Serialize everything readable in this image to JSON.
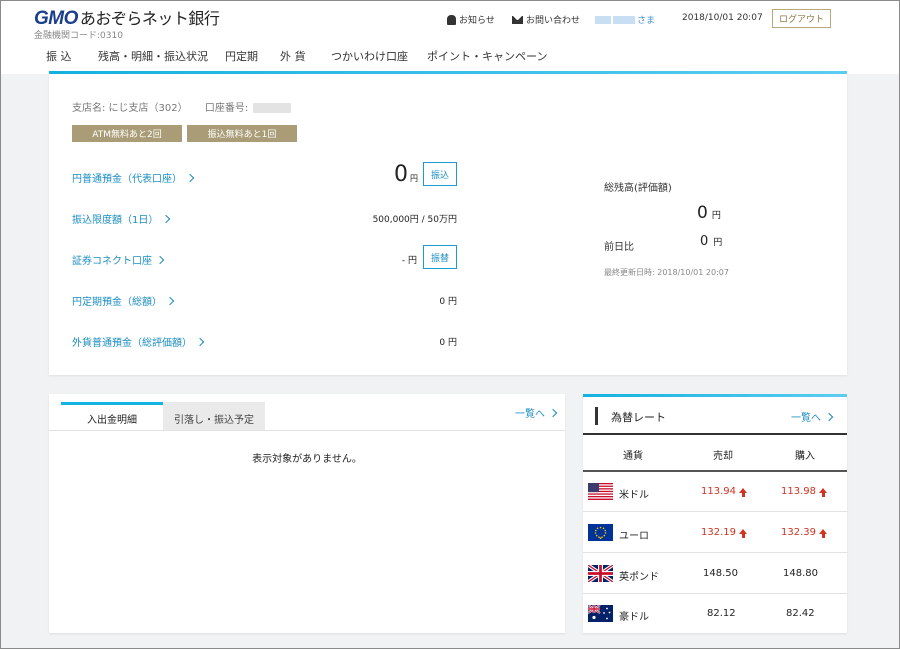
{
  "header": {
    "brand_gmo": "GMO",
    "brand_bank": "あおぞらネット銀行",
    "institution_code": "金融機関コード:0310",
    "notice": "お知らせ",
    "contact": "お問い合わせ",
    "user_suffix": "さま",
    "datetime": "2018/10/01 20:07",
    "logout": "ログアウト"
  },
  "nav": [
    {
      "label": "振 込"
    },
    {
      "label": "残高・明細・振込状況"
    },
    {
      "label": "円定期"
    },
    {
      "label": "外 貨"
    },
    {
      "label": "つかいわけ口座"
    },
    {
      "label": "ポイント・キャンペーン"
    }
  ],
  "account": {
    "branch": "支店名: にじ支店（302）",
    "account_label": "口座番号:",
    "badges": [
      "ATM無料あと2回",
      "振込無料あと1回"
    ],
    "rows": [
      {
        "label": "円普通預金（代表口座）",
        "amount": "0",
        "unit": "円",
        "button": "振込"
      },
      {
        "label": "振込限度額（1日）",
        "amount": "500,000円 / 50万円"
      },
      {
        "label": "証券コネクト口座",
        "amount": "- 円",
        "button": "振替"
      },
      {
        "label": "円定期預金（総額）",
        "amount": "0 円"
      },
      {
        "label": "外貨普通預金（総評価額）",
        "amount": "0 円"
      }
    ]
  },
  "summary": {
    "total_label": "総残高(評価額)",
    "total_amount": "0",
    "total_unit": "円",
    "prev_label": "前日比",
    "prev_amount": "0",
    "prev_unit": "円",
    "updated": "最終更新日時: 2018/10/01 20:07"
  },
  "transactions": {
    "tabs": [
      "入出金明細",
      "引落し・振込予定"
    ],
    "list_link": "一覧へ",
    "empty_message": "表示対象がありません。"
  },
  "fx": {
    "title": "為替レート",
    "list_link": "一覧へ",
    "headers": [
      "通貨",
      "売却",
      "購入"
    ],
    "rows": [
      {
        "name": "米ドル",
        "sell": "113.94",
        "buy": "113.98",
        "sell_up": true,
        "buy_up": true
      },
      {
        "name": "ユーロ",
        "sell": "132.19",
        "buy": "132.39",
        "sell_up": true,
        "buy_up": true
      },
      {
        "name": "英ポンド",
        "sell": "148.50",
        "buy": "148.80",
        "sell_up": false,
        "buy_up": false
      },
      {
        "name": "豪ドル",
        "sell": "82.12",
        "buy": "82.42",
        "sell_up": false,
        "buy_up": false
      }
    ]
  },
  "colors": {
    "accent": "#14b2df",
    "link": "#1b8dc0",
    "badge": "#a99c77",
    "up": "#d0331f",
    "brand": "#1a3e8c"
  }
}
